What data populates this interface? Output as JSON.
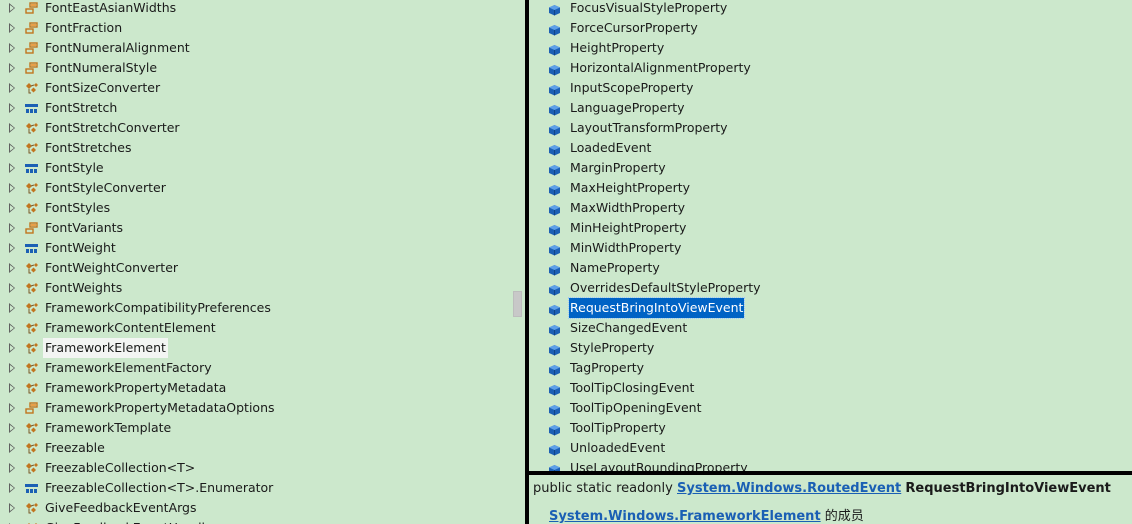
{
  "type_tree": {
    "items": [
      {
        "label": "FontEastAsianWidths",
        "icon": "enum-icon"
      },
      {
        "label": "FontFraction",
        "icon": "enum-icon"
      },
      {
        "label": "FontNumeralAlignment",
        "icon": "enum-icon"
      },
      {
        "label": "FontNumeralStyle",
        "icon": "enum-icon"
      },
      {
        "label": "FontSizeConverter",
        "icon": "class-icon"
      },
      {
        "label": "FontStretch",
        "icon": "struct-icon"
      },
      {
        "label": "FontStretchConverter",
        "icon": "class-icon"
      },
      {
        "label": "FontStretches",
        "icon": "class-icon"
      },
      {
        "label": "FontStyle",
        "icon": "struct-icon"
      },
      {
        "label": "FontStyleConverter",
        "icon": "class-icon"
      },
      {
        "label": "FontStyles",
        "icon": "class-icon"
      },
      {
        "label": "FontVariants",
        "icon": "enum-icon"
      },
      {
        "label": "FontWeight",
        "icon": "struct-icon"
      },
      {
        "label": "FontWeightConverter",
        "icon": "class-icon"
      },
      {
        "label": "FontWeights",
        "icon": "class-icon"
      },
      {
        "label": "FrameworkCompatibilityPreferences",
        "icon": "class-icon"
      },
      {
        "label": "FrameworkContentElement",
        "icon": "class-icon"
      },
      {
        "label": "FrameworkElement",
        "icon": "class-icon",
        "selected": true
      },
      {
        "label": "FrameworkElementFactory",
        "icon": "class-icon"
      },
      {
        "label": "FrameworkPropertyMetadata",
        "icon": "class-icon"
      },
      {
        "label": "FrameworkPropertyMetadataOptions",
        "icon": "enum-icon"
      },
      {
        "label": "FrameworkTemplate",
        "icon": "class-icon"
      },
      {
        "label": "Freezable",
        "icon": "class-icon"
      },
      {
        "label": "FreezableCollection<T>",
        "icon": "class-icon"
      },
      {
        "label": "FreezableCollection<T>.Enumerator",
        "icon": "struct-icon"
      },
      {
        "label": "GiveFeedbackEventArgs",
        "icon": "class-icon"
      },
      {
        "label": "GiveFeedbackEventHandler",
        "icon": "class-icon"
      }
    ]
  },
  "member_list": {
    "items": [
      {
        "label": "FocusVisualStyleProperty"
      },
      {
        "label": "ForceCursorProperty"
      },
      {
        "label": "HeightProperty"
      },
      {
        "label": "HorizontalAlignmentProperty"
      },
      {
        "label": "InputScopeProperty"
      },
      {
        "label": "LanguageProperty"
      },
      {
        "label": "LayoutTransformProperty"
      },
      {
        "label": "LoadedEvent"
      },
      {
        "label": "MarginProperty"
      },
      {
        "label": "MaxHeightProperty"
      },
      {
        "label": "MaxWidthProperty"
      },
      {
        "label": "MinHeightProperty"
      },
      {
        "label": "MinWidthProperty"
      },
      {
        "label": "NameProperty"
      },
      {
        "label": "OverridesDefaultStyleProperty"
      },
      {
        "label": "RequestBringIntoViewEvent",
        "selected": true
      },
      {
        "label": "SizeChangedEvent"
      },
      {
        "label": "StyleProperty"
      },
      {
        "label": "TagProperty"
      },
      {
        "label": "ToolTipClosingEvent"
      },
      {
        "label": "ToolTipOpeningEvent"
      },
      {
        "label": "ToolTipProperty"
      },
      {
        "label": "UnloadedEvent"
      },
      {
        "label": "UseLayoutRoundingProperty"
      }
    ]
  },
  "detail": {
    "prefix": "public static readonly",
    "type_link": "System.Windows.RoutedEvent",
    "member_name": "RequestBringIntoViewEvent",
    "owner_ns_link": "System.Windows.",
    "owner_type_link": "FrameworkElement",
    "member_of_suffix": "的成员"
  },
  "colors": {
    "background": "#cce8cc",
    "selection": "#0063c5",
    "link": "#1a5fb4",
    "class_icon": "#c1751f",
    "member_icon": "#1b5fb4"
  }
}
